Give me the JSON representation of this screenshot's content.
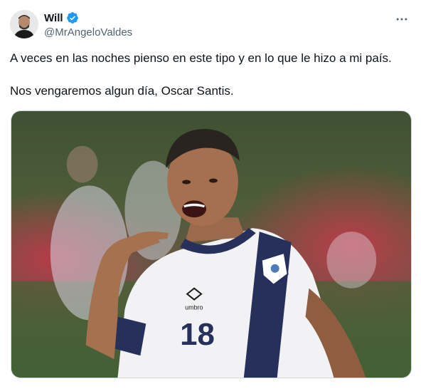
{
  "author": {
    "display_name": "Will",
    "handle": "@MrAngeloValdes",
    "verified": true,
    "avatar_icon": "user-avatar"
  },
  "tweet": {
    "paragraphs": [
      "A veces en las noches pienso en este tipo y en lo que le hizo a mi país.",
      "Nos vengaremos algun día, Oscar Santis."
    ]
  },
  "media": {
    "jersey_number": "18",
    "jersey_brand": "umbro"
  },
  "colors": {
    "verified_blue": "#1d9bf0",
    "text_primary": "#0f1419",
    "text_secondary": "#536471",
    "border": "#cfd9de",
    "jersey_navy": "#27305a"
  },
  "icons": {
    "more": "more-dots-icon",
    "verified": "verified-badge-icon"
  }
}
